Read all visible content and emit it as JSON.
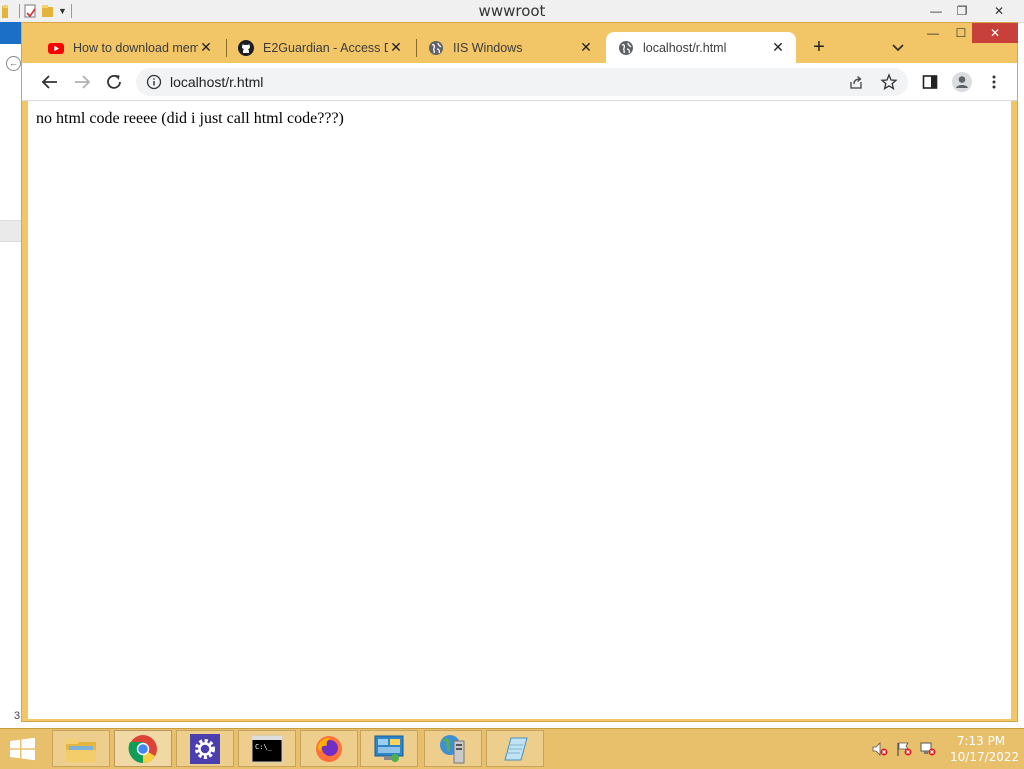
{
  "background_window": {
    "title": "wwwroot",
    "status_count": "3",
    "controls": {
      "minimize": "—",
      "restore": "❐",
      "close": "✕"
    }
  },
  "browser": {
    "tabs": [
      {
        "label": "How to download mem",
        "favicon": "youtube-icon",
        "close": "✕"
      },
      {
        "label": "E2Guardian - Access De",
        "favicon": "github-icon",
        "close": "✕"
      },
      {
        "label": "IIS Windows",
        "favicon": "globe-icon",
        "close": "✕"
      },
      {
        "label": "localhost/r.html",
        "favicon": "globe-icon",
        "close": "✕",
        "active": true
      }
    ],
    "new_tab": "+",
    "window_controls": {
      "minimize": "—",
      "maximize": "☐",
      "close": "✕"
    },
    "address": {
      "value": "localhost/r.html"
    },
    "accent": "#f2c567"
  },
  "page": {
    "text": "no html code reeee (did i just call html code???)"
  },
  "taskbar": {
    "apps": [
      {
        "name": "file-explorer",
        "icon": "folder-icon"
      },
      {
        "name": "chrome",
        "icon": "chrome-icon",
        "active": true
      },
      {
        "name": "settings",
        "icon": "gear-icon"
      },
      {
        "name": "command-prompt",
        "icon": "cmd-icon"
      },
      {
        "name": "firefox",
        "icon": "firefox-icon"
      },
      {
        "name": "control-panel",
        "icon": "control-panel-icon"
      },
      {
        "name": "server-manager",
        "icon": "server-icon"
      },
      {
        "name": "notepad",
        "icon": "notepad-icon"
      }
    ],
    "clock": {
      "time": "7:13 PM",
      "date": "10/17/2022"
    }
  }
}
